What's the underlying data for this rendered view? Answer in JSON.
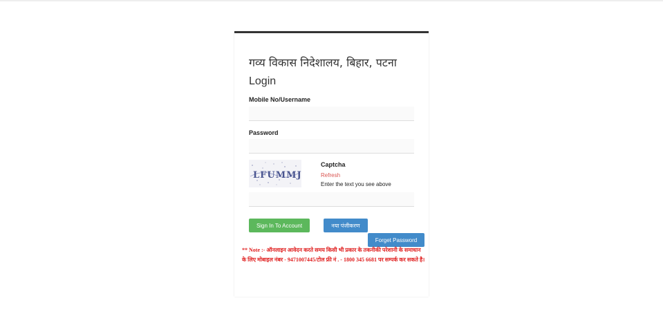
{
  "header": {
    "department_title": "गव्य विकास निदेशालय, बिहार, पटना",
    "login_heading": "Login"
  },
  "form": {
    "username_label": "Mobile No/Username",
    "username_value": "",
    "password_label": "Password",
    "password_value": "",
    "captcha_label": "Captcha",
    "captcha_image_text": "LFUMMJ",
    "refresh_label": "Refresh",
    "captcha_hint": "Enter the text you see above",
    "captcha_value": ""
  },
  "buttons": {
    "sign_in": "Sign In To Account",
    "register": "नया पंजीकरण",
    "forgot_password": "Forget Password"
  },
  "note": "** Note :- ऑनलाइन आवेदन करते समय किसी भी प्रकार के तकनीकी परेशानी के समाधान के लिए मोबाइल नंबर - 9471007445/टोल फ्री नं . - 1800 345 6681 पर सम्पर्क कर सकते है।",
  "colors": {
    "card_top_border": "#333333",
    "sign_in_button": "#5cb85c",
    "secondary_buttons": "#428bca",
    "note_text": "#e02020",
    "refresh_link": "#d9534f"
  }
}
